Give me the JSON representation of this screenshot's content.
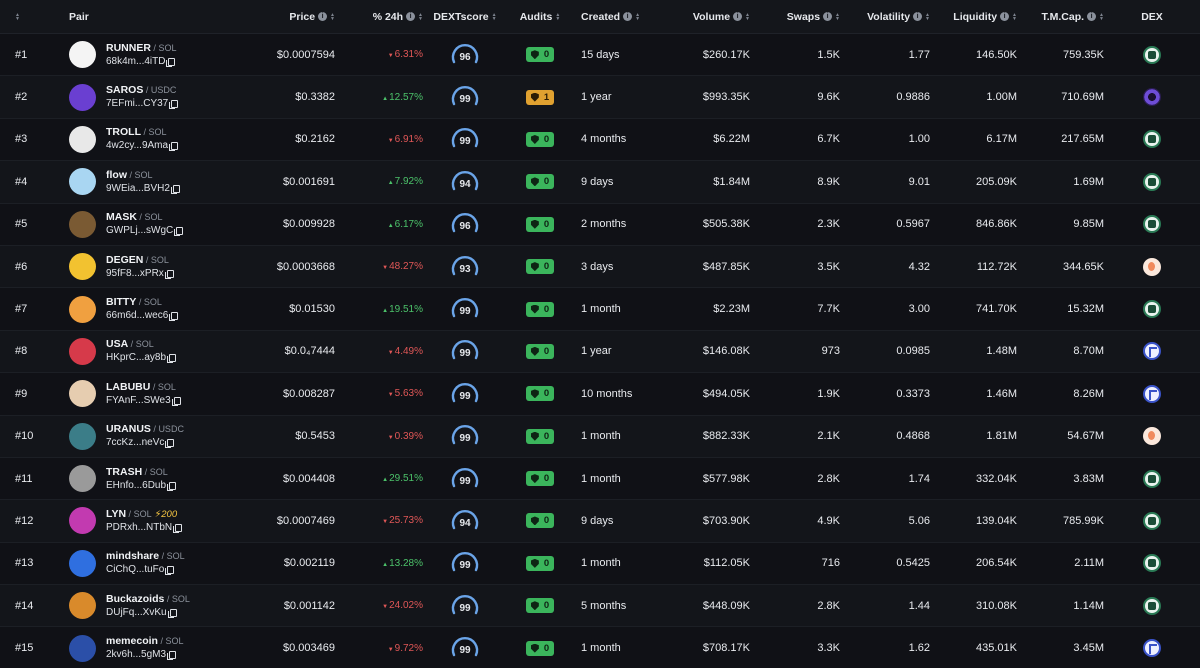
{
  "headers": {
    "pair": "Pair",
    "price": "Price",
    "change": "% 24h",
    "score": "DEXTscore",
    "audits": "Audits",
    "created": "Created",
    "volume": "Volume",
    "swaps": "Swaps",
    "volatility": "Volatility",
    "liquidity": "Liquidity",
    "mcap": "T.M.Cap.",
    "dex": "DEX"
  },
  "colors": {
    "positive": "#4cc26a",
    "negative": "#e05757",
    "audit_ok": "#3bb55c",
    "audit_warn": "#e0a130",
    "gauge": "#6aa4e8"
  },
  "rows": [
    {
      "rank": "#1",
      "name": "RUNNER",
      "quote": "SOL",
      "addr": "68k4m...4iTD",
      "price": "$0.0007594",
      "change": "6.31%",
      "dir": "neg",
      "score": "96",
      "audit": "0",
      "audit_type": "ok",
      "created": "15 days",
      "volume": "$260.17K",
      "swaps": "1.5K",
      "volatility": "1.77",
      "liquidity": "146.50K",
      "mcap": "759.35K",
      "dex": "raydium-icon",
      "avatar": "#f4f4f4"
    },
    {
      "rank": "#2",
      "name": "SAROS",
      "quote": "USDC",
      "addr": "7EFmi...CY37",
      "price": "$0.3382",
      "change": "12.57%",
      "dir": "pos",
      "score": "99",
      "audit": "1",
      "audit_type": "warn",
      "created": "1 year",
      "volume": "$993.35K",
      "swaps": "9.6K",
      "volatility": "0.9886",
      "liquidity": "1.00M",
      "mcap": "710.69M",
      "dex": "saros-icon",
      "avatar": "#6a3fd1"
    },
    {
      "rank": "#3",
      "name": "TROLL",
      "quote": "SOL",
      "addr": "4w2cy...9Ama",
      "price": "$0.2162",
      "change": "6.91%",
      "dir": "neg",
      "score": "99",
      "audit": "0",
      "audit_type": "ok",
      "created": "4 months",
      "volume": "$6.22M",
      "swaps": "6.7K",
      "volatility": "1.00",
      "liquidity": "6.17M",
      "mcap": "217.65M",
      "dex": "raydium-icon",
      "avatar": "#e8e8e8"
    },
    {
      "rank": "#4",
      "name": "flow",
      "quote": "SOL",
      "addr": "9WEia...BVH2",
      "price": "$0.001691",
      "change": "7.92%",
      "dir": "pos",
      "score": "94",
      "audit": "0",
      "audit_type": "ok",
      "created": "9 days",
      "volume": "$1.84M",
      "swaps": "8.9K",
      "volatility": "9.01",
      "liquidity": "205.09K",
      "mcap": "1.69M",
      "dex": "raydium-icon",
      "avatar": "#a9d6f2"
    },
    {
      "rank": "#5",
      "name": "MASK",
      "quote": "SOL",
      "addr": "GWPLj...sWgC",
      "price": "$0.009928",
      "change": "6.17%",
      "dir": "pos",
      "score": "96",
      "audit": "0",
      "audit_type": "ok",
      "created": "2 months",
      "volume": "$505.38K",
      "swaps": "2.3K",
      "volatility": "0.5967",
      "liquidity": "846.86K",
      "mcap": "9.85M",
      "dex": "raydium-icon",
      "avatar": "#7a5a33"
    },
    {
      "rank": "#6",
      "name": "DEGEN",
      "quote": "SOL",
      "addr": "95fF8...xPRx",
      "price": "$0.0003668",
      "change": "48.27%",
      "dir": "neg",
      "score": "93",
      "audit": "0",
      "audit_type": "ok",
      "created": "3 days",
      "volume": "$487.85K",
      "swaps": "3.5K",
      "volatility": "4.32",
      "liquidity": "112.72K",
      "mcap": "344.65K",
      "dex": "pump-icon",
      "avatar": "#f2c230"
    },
    {
      "rank": "#7",
      "name": "BITTY",
      "quote": "SOL",
      "addr": "66m6d...wec6",
      "price": "$0.01530",
      "change": "19.51%",
      "dir": "pos",
      "score": "99",
      "audit": "0",
      "audit_type": "ok",
      "created": "1 month",
      "volume": "$2.23M",
      "swaps": "7.7K",
      "volatility": "3.00",
      "liquidity": "741.70K",
      "mcap": "15.32M",
      "dex": "raydium-icon",
      "avatar": "#f0a040"
    },
    {
      "rank": "#8",
      "name": "USA",
      "quote": "SOL",
      "addr": "HKprC...ay8b",
      "price": "$0.0₄7444",
      "change": "4.49%",
      "dir": "neg",
      "score": "99",
      "audit": "0",
      "audit_type": "ok",
      "created": "1 year",
      "volume": "$146.08K",
      "swaps": "973",
      "volatility": "0.0985",
      "liquidity": "1.48M",
      "mcap": "8.70M",
      "dex": "meteora-icon",
      "avatar": "#d63a4a"
    },
    {
      "rank": "#9",
      "name": "LABUBU",
      "quote": "SOL",
      "addr": "FYAnF...SWe3",
      "price": "$0.008287",
      "change": "5.63%",
      "dir": "neg",
      "score": "99",
      "audit": "0",
      "audit_type": "ok",
      "created": "10 months",
      "volume": "$494.05K",
      "swaps": "1.9K",
      "volatility": "0.3373",
      "liquidity": "1.46M",
      "mcap": "8.26M",
      "dex": "meteora-icon",
      "avatar": "#e6cdb0"
    },
    {
      "rank": "#10",
      "name": "URANUS",
      "quote": "USDC",
      "addr": "7ccKz...neVc",
      "price": "$0.5453",
      "change": "0.39%",
      "dir": "neg",
      "score": "99",
      "audit": "0",
      "audit_type": "ok",
      "created": "1 month",
      "volume": "$882.33K",
      "swaps": "2.1K",
      "volatility": "0.4868",
      "liquidity": "1.81M",
      "mcap": "54.67M",
      "dex": "pump-icon",
      "avatar": "#3b7d88"
    },
    {
      "rank": "#11",
      "name": "TRASH",
      "quote": "SOL",
      "addr": "EHnfo...6Dub",
      "price": "$0.004408",
      "change": "29.51%",
      "dir": "pos",
      "score": "99",
      "audit": "0",
      "audit_type": "ok",
      "created": "1 month",
      "volume": "$577.98K",
      "swaps": "2.8K",
      "volatility": "1.74",
      "liquidity": "332.04K",
      "mcap": "3.83M",
      "dex": "raydium-icon",
      "avatar": "#9a9a9a"
    },
    {
      "rank": "#12",
      "name": "LYN",
      "quote": "SOL",
      "boost": "⚡200",
      "addr": "PDRxh...NTbN",
      "price": "$0.0007469",
      "change": "25.73%",
      "dir": "neg",
      "score": "94",
      "audit": "0",
      "audit_type": "ok",
      "created": "9 days",
      "volume": "$703.90K",
      "swaps": "4.9K",
      "volatility": "5.06",
      "liquidity": "139.04K",
      "mcap": "785.99K",
      "dex": "raydium-icon",
      "avatar": "#c23ab0"
    },
    {
      "rank": "#13",
      "name": "mindshare",
      "quote": "SOL",
      "addr": "CiChQ...tuFo",
      "price": "$0.002119",
      "change": "13.28%",
      "dir": "pos",
      "score": "99",
      "audit": "0",
      "audit_type": "ok",
      "created": "1 month",
      "volume": "$112.05K",
      "swaps": "716",
      "volatility": "0.5425",
      "liquidity": "206.54K",
      "mcap": "2.11M",
      "dex": "raydium-icon",
      "avatar": "#2f6fe0"
    },
    {
      "rank": "#14",
      "name": "Buckazoids",
      "quote": "SOL",
      "addr": "DUjFq...XvKu",
      "price": "$0.001142",
      "change": "24.02%",
      "dir": "neg",
      "score": "99",
      "audit": "0",
      "audit_type": "ok",
      "created": "5 months",
      "volume": "$448.09K",
      "swaps": "2.8K",
      "volatility": "1.44",
      "liquidity": "310.08K",
      "mcap": "1.14M",
      "dex": "raydium-icon",
      "avatar": "#d98a2b"
    },
    {
      "rank": "#15",
      "name": "memecoin",
      "quote": "SOL",
      "addr": "2kv6h...5gM3",
      "price": "$0.003469",
      "change": "9.72%",
      "dir": "neg",
      "score": "99",
      "audit": "0",
      "audit_type": "ok",
      "created": "1 month",
      "volume": "$708.17K",
      "swaps": "3.3K",
      "volatility": "1.62",
      "liquidity": "435.01K",
      "mcap": "3.45M",
      "dex": "meteora-icon",
      "avatar": "#2b4fa8"
    }
  ]
}
